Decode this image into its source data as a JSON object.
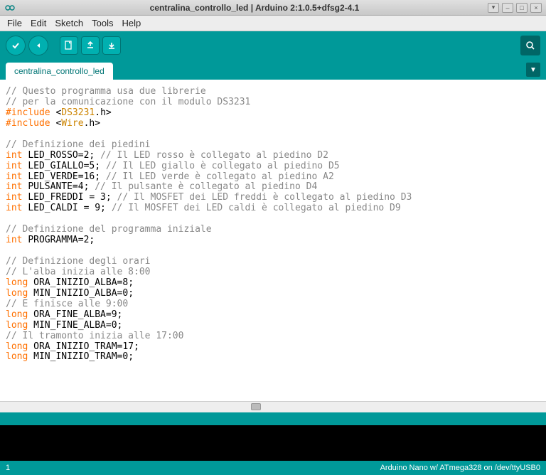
{
  "window": {
    "title": "centralina_controllo_led | Arduino 2:1.0.5+dfsg2-4.1"
  },
  "menu": {
    "file": "File",
    "edit": "Edit",
    "sketch": "Sketch",
    "tools": "Tools",
    "help": "Help"
  },
  "tabs": {
    "main": "centralina_controllo_led"
  },
  "code": {
    "c01": "// Questo programma usa due librerie",
    "c02": "// per la comunicazione con il modulo DS3231",
    "inc": "#include",
    "lib1": "DS3231",
    "lib2": "Wire",
    "c03": "// Definizione dei piedini",
    "t_int": "int",
    "t_long": "long",
    "l01a": "LED_ROSSO=2; ",
    "l01c": "// Il LED rosso è collegato al piedino D2",
    "l02a": "LED_GIALLO=5; ",
    "l02c": "// Il LED giallo è collegato al piedino D5",
    "l03a": "LED_VERDE=16; ",
    "l03c": "// Il LED verde è collegato al piedino A2",
    "l04a": "PULSANTE=4; ",
    "l04c": "// Il pulsante è collegato al piedino D4",
    "l05a": "LED_FREDDI = 3; ",
    "l05c": "// Il MOSFET dei LED freddi è collegato al piedino D3",
    "l06a": "LED_CALDI = 9; ",
    "l06c": "// Il MOSFET dei LED caldi è collegato al piedino D9",
    "c04": "// Definizione del programma iniziale",
    "l07": "PROGRAMMA=2;",
    "c05": "// Definizione degli orari",
    "c06": "// L'alba inizia alle 8:00",
    "l08": "ORA_INIZIO_ALBA=8;",
    "l09": "MIN_INIZIO_ALBA=0;",
    "c07": "// E finisce alle 9:00",
    "l10": "ORA_FINE_ALBA=9;",
    "l11": "MIN_FINE_ALBA=0;",
    "c08": "// Il tramonto inizia alle 17:00",
    "l12": "ORA_INIZIO_TRAM=17;",
    "l13": "MIN_INIZIO_TRAM=0;"
  },
  "status": {
    "line": "1",
    "board": "Arduino Nano w/ ATmega328 on /dev/ttyUSB0"
  }
}
